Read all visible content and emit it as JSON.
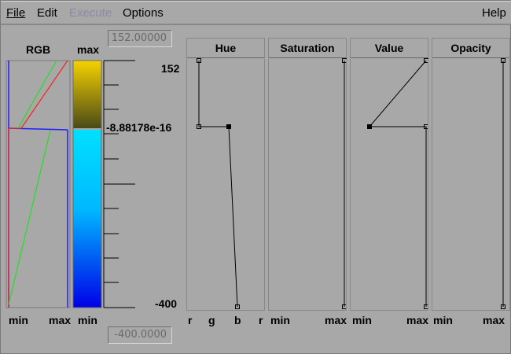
{
  "menu": {
    "file": "File",
    "edit": "Edit",
    "execute": "Execute",
    "options": "Options",
    "help": "Help"
  },
  "columns": {
    "rgb": "RGB",
    "max": "max"
  },
  "range": {
    "max_value": "152.00000",
    "min_value": "-400.0000",
    "label_top": "152",
    "label_mid": "-8.88178e-16",
    "label_bottom": "-400"
  },
  "bottom_labels": {
    "rgb_min": "min",
    "rgb_max": "max",
    "colorbar_min": "min",
    "hue_r": "r",
    "hue_g": "g",
    "hue_b": "b",
    "hue_r2": "r",
    "sat_min": "min",
    "sat_max": "max",
    "val_min": "min",
    "val_max": "max",
    "op_min": "min",
    "op_max": "max"
  },
  "editors": {
    "hue": "Hue",
    "saturation": "Saturation",
    "value": "Value",
    "opacity": "Opacity"
  },
  "colors": {
    "background": "#a8a8a8",
    "red_curve": "#ff2020",
    "green_curve": "#20e020",
    "blue_curve": "#2020ff",
    "colorbar_top": "#f6d200",
    "colorbar_upper_bottom": "#4a4a18",
    "colorbar_lower_top": "#00e0ff",
    "colorbar_lower_bottom": "#0000e8"
  }
}
